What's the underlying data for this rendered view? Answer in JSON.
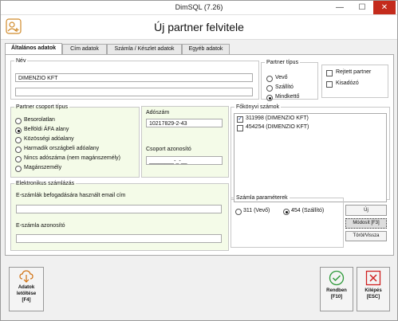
{
  "window": {
    "title": "DimSQL (7.26)",
    "minimize": "—",
    "maximize": "☐",
    "close": "✕"
  },
  "header": {
    "title": "Új partner felvitele"
  },
  "tabs": [
    "Általános adatok",
    "Cím adatok",
    "Számla / Készlet adatok",
    "Egyéb adatok"
  ],
  "name_group": {
    "legend": "Név",
    "value1": "DIMENZIO KFT",
    "value2": ""
  },
  "partner_type": {
    "legend": "Partner típus",
    "options": [
      "Vevő",
      "Szállító",
      "Mindkettő"
    ],
    "selected": "Mindkettő"
  },
  "flags": {
    "hidden_label": "Rejtett partner",
    "excluded_label": "Kisadózó"
  },
  "group_type": {
    "legend": "Partner csoport típus",
    "options": [
      "Besorolatlan",
      "Belföldi ÁFA alany",
      "Közösségi adóalany",
      "Harmadik országbeli adóalany",
      "Nincs adószáma (nem magánszemély)",
      "Magánszemély"
    ],
    "selected": "Belföldi ÁFA alany"
  },
  "tax": {
    "label": "Adószám",
    "value": "10217829-2-43",
    "group_label": "Csoport azonosító",
    "group_value": "________-_-__"
  },
  "ledger": {
    "legend": "Főkönyvi számok",
    "items": [
      {
        "text": "311998 (DIMENZIO KFT)",
        "checked": true
      },
      {
        "text": "454254 (DIMENZIO KFT)",
        "checked": false
      }
    ]
  },
  "invoice_params": {
    "legend": "Számla paraméterek",
    "options": [
      "311 (Vevő)",
      "454 (Szállító)"
    ],
    "selected": "454 (Szállító)"
  },
  "side_buttons": {
    "new": "Új",
    "modify": "Módosít [F3]",
    "delete": "Töröl/Vissza"
  },
  "einvoice": {
    "legend": "Elektronikus számlázás",
    "email_label": "E-számlák befogadására használt email cím",
    "email_value": "",
    "id_label": "E-számla azonosító",
    "id_value": ""
  },
  "bottom": {
    "download_line1": "Adatok",
    "download_line2": "letöltése",
    "download_key": "[F4]",
    "ok_line1": "Rendben",
    "ok_key": "[F10]",
    "exit_line1": "Kilépés",
    "exit_key": "[ESC]"
  }
}
